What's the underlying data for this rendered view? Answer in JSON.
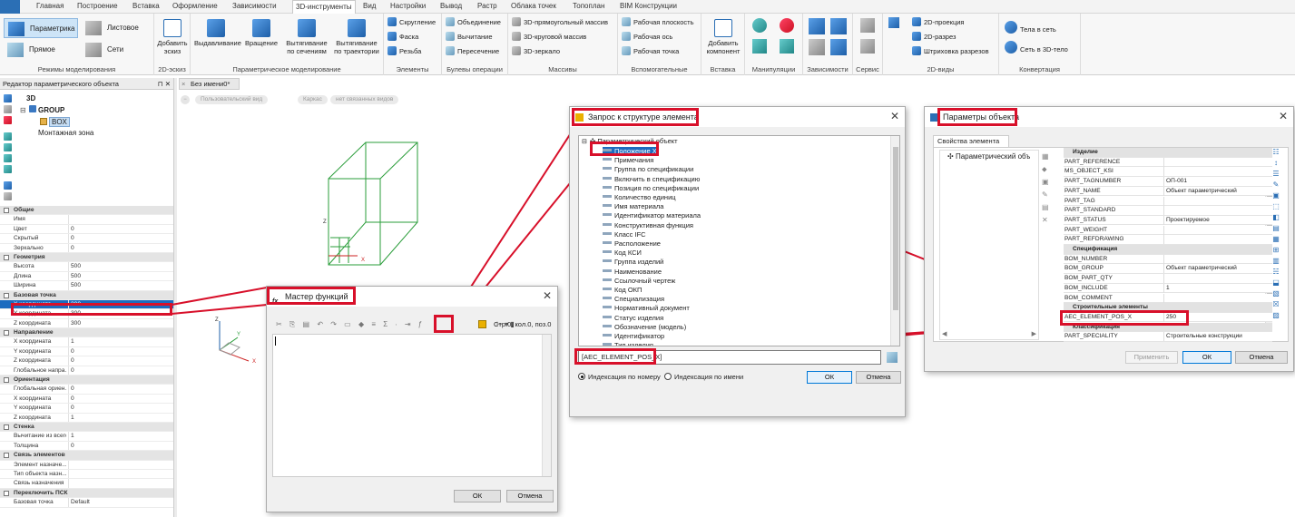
{
  "menu": [
    "Главная",
    "Построение",
    "Вставка",
    "Оформление",
    "Зависимости",
    "3D-инструменты",
    "Вид",
    "Настройки",
    "Вывод",
    "Растр",
    "Облака точек",
    "Топоплан",
    "BIM Конструкции"
  ],
  "menu_active": "3D-инструменты",
  "ribbon": {
    "modes": {
      "title": "Режимы моделирования",
      "b1": "Параметрика",
      "b2": "Листовое",
      "b3": "Прямое",
      "b4": "Сети"
    },
    "sketch": {
      "title": "2D-эскиз",
      "b1": "Добавить\nэскиз"
    },
    "param": {
      "title": "Параметрическое моделирование",
      "b1": "Выдавливание",
      "b2": "Вращение",
      "b3": "Вытягивание\nпо сечениям",
      "b4": "Вытягивание\nпо траектории"
    },
    "elements": {
      "title": "Элементы",
      "b1": "Скругление",
      "b2": "Фаска",
      "b3": "Резьба"
    },
    "boolean": {
      "title": "Булевы операции",
      "b1": "Объединение",
      "b2": "Вычитание",
      "b3": "Пересечение"
    },
    "arrays": {
      "title": "Массивы",
      "b1": "3D-прямоугольный массив",
      "b2": "3D-круговой массив",
      "b3": "3D-зеркало"
    },
    "aux": {
      "title": "Вспомогательные",
      "b1": "Рабочая плоскость",
      "b2": "Рабочая ось",
      "b3": "Рабочая точка"
    },
    "insert": {
      "title": "Вставка",
      "b1": "Добавить\nкомпонент"
    },
    "manip": {
      "title": "Манипуляции"
    },
    "deps": {
      "title": "Зависимости"
    },
    "service": {
      "title": "Сервис"
    },
    "views2d": {
      "title": "2D-виды",
      "b1": "2D-проекция",
      "b2": "2D-разрез",
      "b3": "Штриховка разрезов"
    },
    "convert": {
      "title": "Конвертация",
      "b1": "Тела в сеть",
      "b2": "Сеть в 3D-тело"
    }
  },
  "left_panel": {
    "title": "Редактор параметрического объекта",
    "tree": [
      "3D",
      "GROUP",
      "BOX",
      "Монтажная зона"
    ],
    "properties": [
      {
        "cat": "Общие"
      },
      {
        "n": "Имя",
        "v": ""
      },
      {
        "n": "Цвет",
        "v": "0"
      },
      {
        "n": "Скрытый",
        "v": "0"
      },
      {
        "n": "Зеркально",
        "v": "0"
      },
      {
        "cat": "Геометрия"
      },
      {
        "n": "Высота",
        "v": "500"
      },
      {
        "n": "Длина",
        "v": "500"
      },
      {
        "n": "Ширина",
        "v": "500"
      },
      {
        "cat": "Базовая точка"
      },
      {
        "n": "X координата",
        "v": "300",
        "sel": true
      },
      {
        "n": "Y координата",
        "v": "300"
      },
      {
        "n": "Z координата",
        "v": "300"
      },
      {
        "cat": "Направление"
      },
      {
        "n": "X координата",
        "v": "1"
      },
      {
        "n": "Y координата",
        "v": "0"
      },
      {
        "n": "Z координата",
        "v": "0"
      },
      {
        "n": "Глобальное напра...",
        "v": "0"
      },
      {
        "cat": "Ориентация"
      },
      {
        "n": "Глобальная ориен...",
        "v": "0"
      },
      {
        "n": "X координата",
        "v": "0"
      },
      {
        "n": "Y координата",
        "v": "0"
      },
      {
        "n": "Z координата",
        "v": "1"
      },
      {
        "cat": "Стенка"
      },
      {
        "n": "Вычитание из всего",
        "v": "1"
      },
      {
        "n": "Толщина",
        "v": "0"
      },
      {
        "cat": "Связь элементов"
      },
      {
        "n": "Элемент назначе...",
        "v": ""
      },
      {
        "n": "Тип объекта назн...",
        "v": ""
      },
      {
        "n": "Связь назначения",
        "v": ""
      },
      {
        "cat": "Переключить ПСК"
      },
      {
        "n": "Базовая точка",
        "v": "Default"
      }
    ]
  },
  "doc_tab": "Без имени0*",
  "crumbs": [
    "Пользовательский вид",
    "Каркас",
    "нет связанных видов"
  ],
  "wizard": {
    "title": "Мастер функций",
    "position": "Стр.0, кол.0, поз.0",
    "ok": "ОК",
    "cancel": "Отмена"
  },
  "query": {
    "title": "Запрос к структуре элемента",
    "root": "Параметрический объект",
    "items": [
      "Положение X",
      "Примечания",
      "Группа по спецификации",
      "Включить в спецификацию",
      "Позиция по спецификации",
      "Количество единиц",
      "Имя материала",
      "Идентификатор материала",
      "Конструктивная функция",
      "Класс IFC",
      "Расположение",
      "Код КСИ",
      "Группа изделий",
      "Наименование",
      "Ссылочный чертеж",
      "Код ОКП",
      "Специализация",
      "Нормативный документ",
      "Статус изделия",
      "Обозначение (модель)",
      "Идентификатор",
      "Тип изделия"
    ],
    "field": "[AEC_ELEMENT_POS_X]",
    "radio1": "Индексация по номеру",
    "radio2": "Индексация по имени",
    "ok": "ОК",
    "cancel": "Отмена"
  },
  "params": {
    "title": "Параметры объекта",
    "tab": "Свойства элемента",
    "tree_root": "Параметрический объ",
    "rows": [
      {
        "cat": "Изделие"
      },
      {
        "n": "PART_REFERENCE",
        "v": ""
      },
      {
        "n": "MS_OBJECT_KSI",
        "v": ""
      },
      {
        "n": "PART_TAGNUMBER",
        "v": "ОП-001"
      },
      {
        "n": "PART_NAME",
        "v": "Объект параметрический"
      },
      {
        "n": "PART_TAG",
        "v": ""
      },
      {
        "n": "PART_STANDARD",
        "v": ""
      },
      {
        "n": "PART_STATUS",
        "v": "Проектируемое"
      },
      {
        "n": "PART_WEIGHT",
        "v": ""
      },
      {
        "n": "PART_REFDRAWING",
        "v": ""
      },
      {
        "cat": "Спецификация"
      },
      {
        "n": "BOM_NUMBER",
        "v": ""
      },
      {
        "n": "BOM_GROUP",
        "v": "Объект параметрический"
      },
      {
        "n": "BOM_PART_QTY",
        "v": ""
      },
      {
        "n": "BOM_INCLUDE",
        "v": "1"
      },
      {
        "n": "BOM_COMMENT",
        "v": ""
      },
      {
        "cat": "Строительные элементы"
      },
      {
        "n": "AEC_ELEMENT_POS_X",
        "v": "250"
      },
      {
        "cat": "Классификация"
      },
      {
        "n": "PART_SPECIALITY",
        "v": "Строительные конструкции"
      }
    ],
    "apply": "Применить",
    "ok": "ОК",
    "cancel": "Отмена"
  },
  "colors": {
    "highlight": "#d8102a",
    "cube": "#2a9d3a",
    "selection": "#1c6bbf"
  }
}
